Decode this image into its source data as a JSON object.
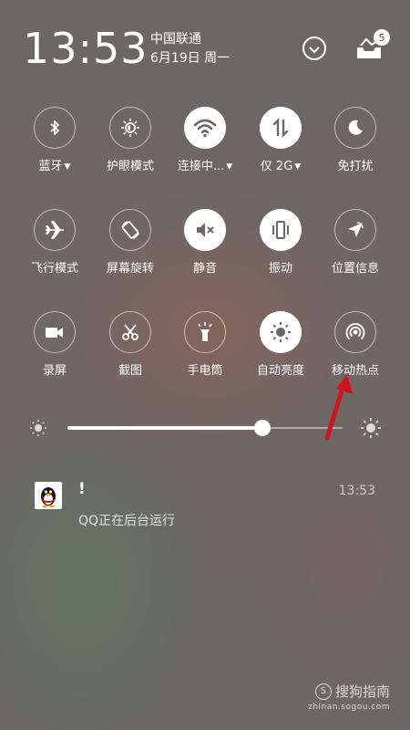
{
  "status_bar": {
    "time": "13:53",
    "carrier": "中国联通",
    "date": "6月19日 周一",
    "notification_count": "5",
    "icons": [
      "chevron-down-icon",
      "inbox-tray-icon"
    ]
  },
  "quick_settings": [
    {
      "label": "蓝牙",
      "icon": "bluetooth-icon",
      "active": false,
      "has_caret": true
    },
    {
      "label": "护眼模式",
      "icon": "eye-care-icon",
      "active": false,
      "has_caret": false
    },
    {
      "label": "连接中...",
      "icon": "wifi-icon",
      "active": true,
      "has_caret": true
    },
    {
      "label": "仅 2G",
      "icon": "mobile-data-icon",
      "active": true,
      "has_caret": true
    },
    {
      "label": "免打扰",
      "icon": "moon-icon",
      "active": false,
      "has_caret": false
    },
    {
      "label": "飞行模式",
      "icon": "airplane-icon",
      "active": false,
      "has_caret": false
    },
    {
      "label": "屏幕旋转",
      "icon": "rotate-icon",
      "active": false,
      "has_caret": false
    },
    {
      "label": "静音",
      "icon": "mute-icon",
      "active": true,
      "has_caret": false
    },
    {
      "label": "振动",
      "icon": "vibrate-icon",
      "active": true,
      "has_caret": false
    },
    {
      "label": "位置信息",
      "icon": "location-icon",
      "active": false,
      "has_caret": false
    },
    {
      "label": "录屏",
      "icon": "screen-record-icon",
      "active": false,
      "has_caret": false
    },
    {
      "label": "截图",
      "icon": "scissors-icon",
      "active": false,
      "has_caret": false
    },
    {
      "label": "手电筒",
      "icon": "flashlight-icon",
      "active": false,
      "has_caret": false
    },
    {
      "label": "自动亮度",
      "icon": "auto-brightness-icon",
      "active": true,
      "has_caret": false
    },
    {
      "label": "移动热点",
      "icon": "hotspot-icon",
      "active": false,
      "has_caret": false
    }
  ],
  "brightness": {
    "level": 0.71,
    "icons": [
      "brightness-low-icon",
      "brightness-high-icon"
    ]
  },
  "notification": {
    "app_icon": "qq-penguin-icon",
    "title": "!",
    "time": "13:53",
    "body": "QQ正在后台运行"
  },
  "annotation": {
    "type": "red-arrow",
    "color": "#d0141b",
    "points_to": "移动热点"
  },
  "watermark": {
    "brand": "搜狗指南",
    "url": "zhinan.sogou.com"
  }
}
